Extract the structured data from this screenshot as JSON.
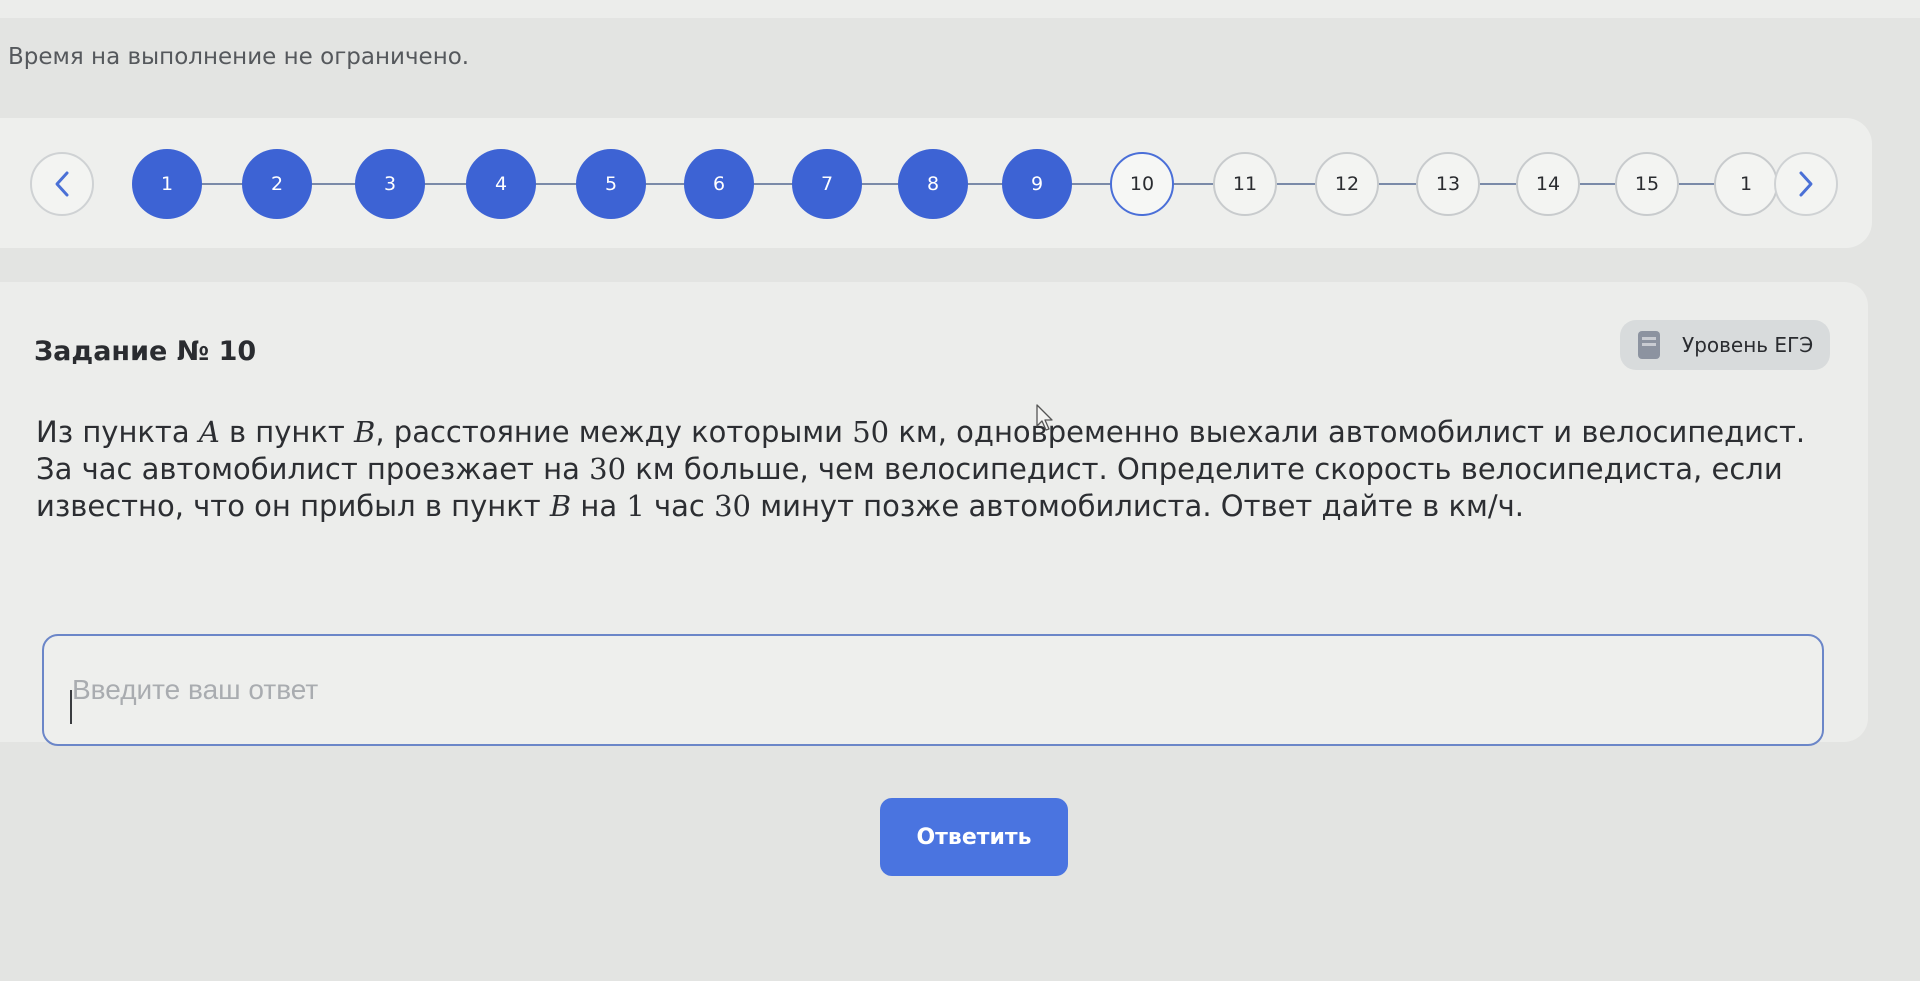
{
  "header": {
    "time_note": "Время на выполнение не ограничено."
  },
  "navigation": {
    "prev_icon": "chevron-left-icon",
    "next_icon": "chevron-right-icon",
    "current_step": "10",
    "steps": [
      {
        "label": "1",
        "state": "done"
      },
      {
        "label": "2",
        "state": "done"
      },
      {
        "label": "3",
        "state": "done"
      },
      {
        "label": "4",
        "state": "done"
      },
      {
        "label": "5",
        "state": "done"
      },
      {
        "label": "6",
        "state": "done"
      },
      {
        "label": "7",
        "state": "done"
      },
      {
        "label": "8",
        "state": "done"
      },
      {
        "label": "9",
        "state": "done"
      },
      {
        "label": "10",
        "state": "current"
      },
      {
        "label": "11",
        "state": "todo"
      },
      {
        "label": "12",
        "state": "todo"
      },
      {
        "label": "13",
        "state": "todo"
      },
      {
        "label": "14",
        "state": "todo"
      },
      {
        "label": "15",
        "state": "todo"
      },
      {
        "label": "1",
        "state": "todo"
      }
    ]
  },
  "task": {
    "title": "Задание № 10",
    "level_badge": "Уровень ЕГЭ",
    "level_icon": "document-icon",
    "text": {
      "t1": "Из пункта ",
      "a": "A",
      "t2": " в пункт ",
      "b1": "B",
      "t3": ", расстояние между которыми ",
      "n50": "50",
      "t4": " км, одновременно выехали автомобилист и велосипедист. За час автомобилист проезжает на ",
      "n30a": "30",
      "t5": " км больше, чем велосипедист. Определите скорость велосипедиста, если известно, что он прибыл в пункт ",
      "b2": "B",
      "t6": " на ",
      "n1": "1",
      "t7": " час ",
      "n30b": "30",
      "t8": " минут позже автомобилиста. Ответ дайте в км/ч."
    }
  },
  "answer": {
    "placeholder": "Введите ваш ответ",
    "value": "",
    "submit_label": "Ответить"
  },
  "colors": {
    "accent": "#4a74e0",
    "step_done": "#3d63d4",
    "background": "#e3e4e2",
    "card": "#ecedeb"
  }
}
